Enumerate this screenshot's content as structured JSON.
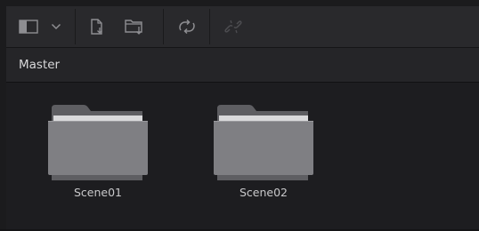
{
  "toolbar": {
    "buttons": [
      {
        "name": "panel-toggle-icon"
      },
      {
        "name": "chevron-down-icon"
      },
      {
        "name": "import-media-icon"
      },
      {
        "name": "import-folder-icon"
      },
      {
        "name": "relink-icon"
      },
      {
        "name": "unlink-icon",
        "disabled": true
      }
    ]
  },
  "header": {
    "title": "Master"
  },
  "bins": [
    {
      "label": "Scene01",
      "icon": "folder-icon"
    },
    {
      "label": "Scene02",
      "icon": "folder-icon"
    }
  ],
  "colors": {
    "toolbar_bg": "#29292c",
    "header_bg": "#252528",
    "content_bg": "#1d1d20",
    "folder_body": "#7f7f83",
    "folder_tab": "#5e5e62",
    "folder_paper": "#d9d9db",
    "icon": "#8e8e92"
  }
}
